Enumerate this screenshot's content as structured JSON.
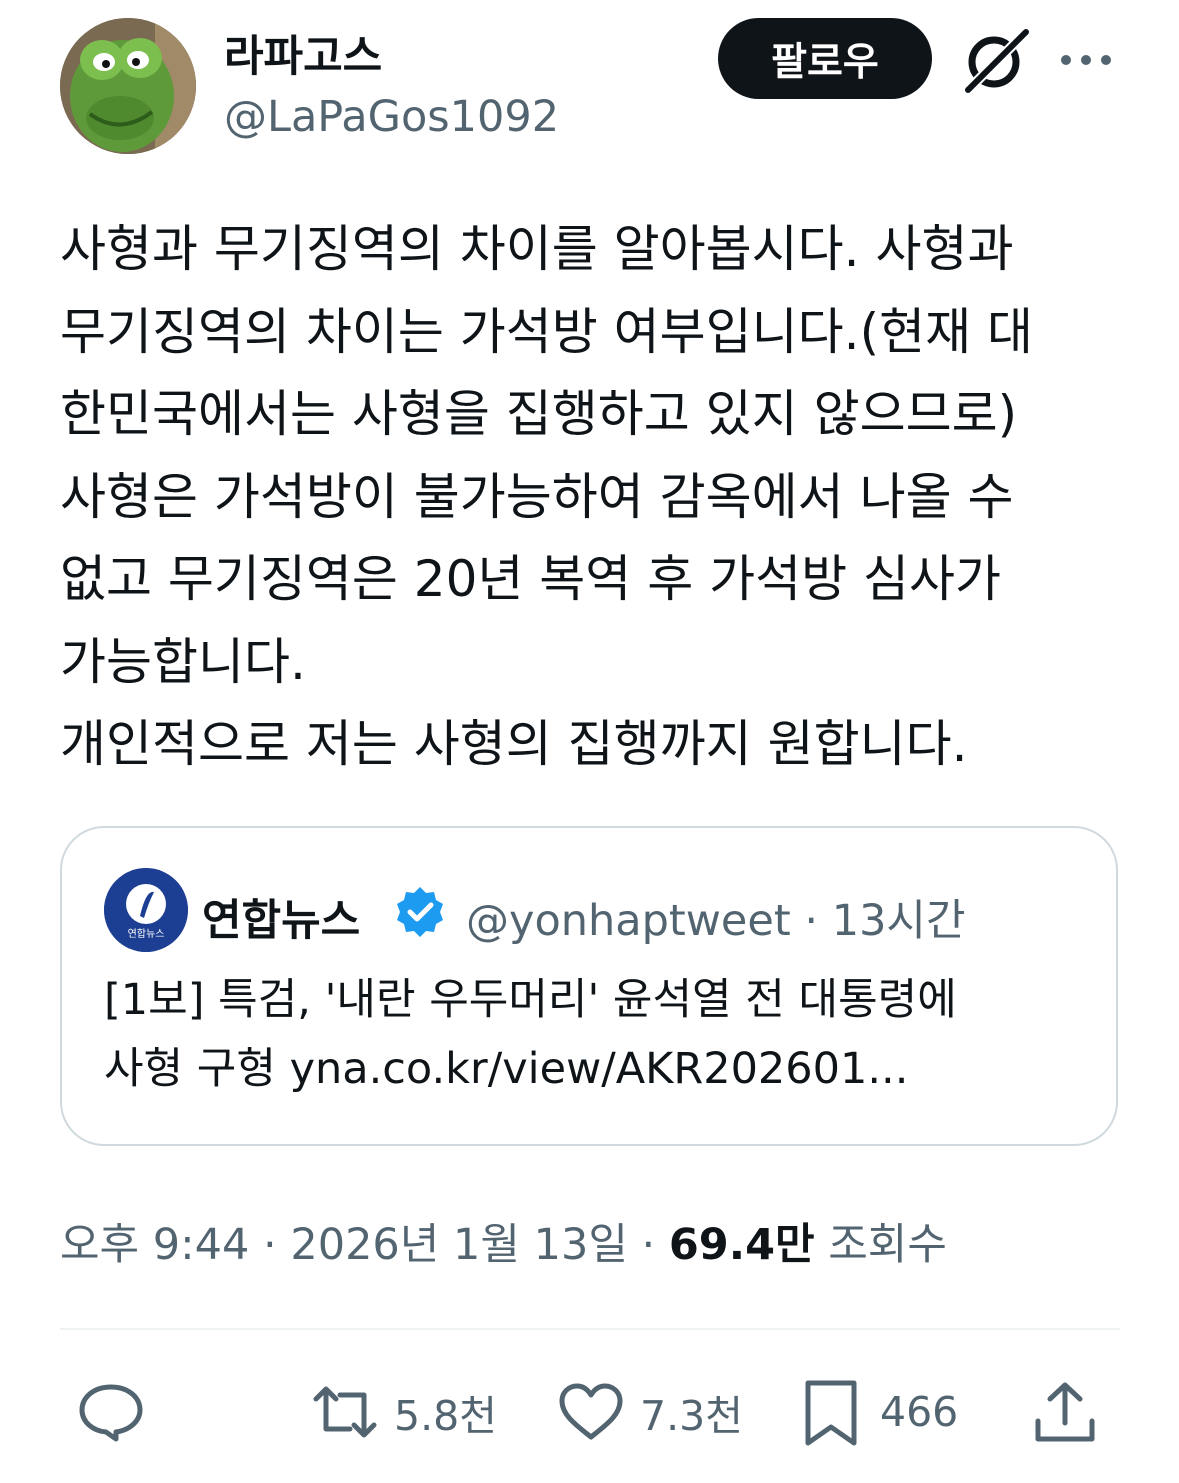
{
  "author": {
    "display_name": "라파고스",
    "handle": "@LaPaGos1092",
    "avatar_icon": "kermit-frog-avatar"
  },
  "header": {
    "follow_label": "팔로우",
    "grok_icon": "grok-icon",
    "more_icon": "more-horizontal-icon"
  },
  "tweet": {
    "lines": [
      "사형과 무기징역의 차이를 알아봅시다. 사형과",
      "무기징역의 차이는 가석방 여부입니다.(현재 대",
      "한민국에서는 사형을 집행하고 있지 않으므로)",
      "사형은 가석방이 불가능하여 감옥에서 나올 수",
      "없고 무기징역은 20년 복역 후 가석방 심사가",
      "가능합니다.",
      "개인적으로 저는 사형의 집행까지 원합니다."
    ]
  },
  "quote": {
    "display_name": "연합뉴스",
    "handle_time": "@yonhaptweet · 13시간",
    "avatar_label": "연합뉴스",
    "verified_icon": "verified-badge-icon",
    "lines": [
      "[1보] 특검, '내란 우두머리' 윤석열 전 대통령에",
      "사형 구형 yna.co.kr/view/AKR202601..."
    ]
  },
  "meta": {
    "timestamp": "오후 9:44 · 2026년 1월 13일 · ",
    "views_count": "69.4만",
    "views_label": " 조회수"
  },
  "actions": {
    "reply_icon": "reply-icon",
    "retweet_count": "5.8천",
    "like_count": "7.3천",
    "bookmark_count": "466",
    "share_icon": "share-icon"
  },
  "colors": {
    "text": "#0f1419",
    "secondary": "#536471",
    "border": "#cfd9de",
    "verified": "#1d9bf0",
    "follow_bg": "#0f1419"
  }
}
